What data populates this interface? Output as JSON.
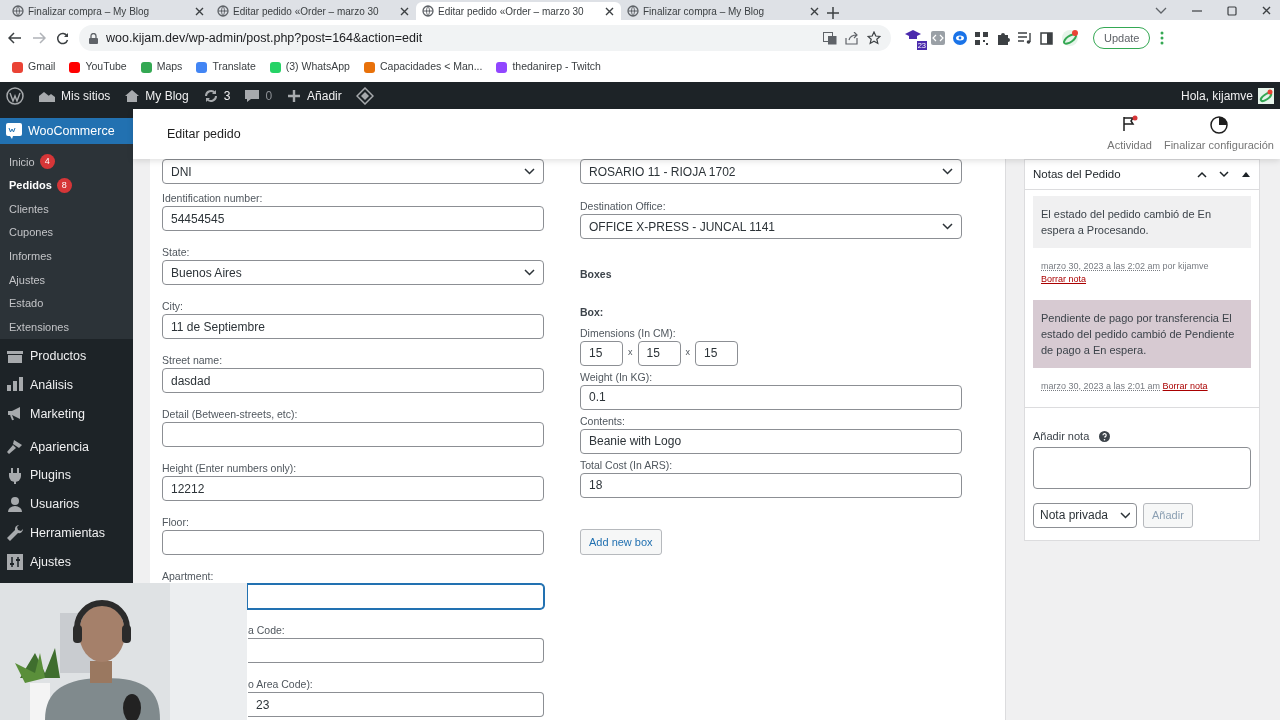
{
  "browser": {
    "tabs": [
      {
        "title": "Finalizar compra – My Blog",
        "selected": false
      },
      {
        "title": "Editar pedido «Order – marzo 30",
        "selected": false
      },
      {
        "title": "Editar pedido «Order – marzo 30",
        "selected": true
      },
      {
        "title": "Finalizar compra – My Blog",
        "selected": false
      }
    ],
    "url": "woo.kijam.dev/wp-admin/post.php?post=164&action=edit",
    "bookmarks": [
      {
        "label": "Gmail",
        "color": "#ea4335"
      },
      {
        "label": "YouTube",
        "color": "#ff0000"
      },
      {
        "label": "Maps",
        "color": "#34a853"
      },
      {
        "label": "Translate",
        "color": "#4285f4"
      },
      {
        "label": "(3) WhatsApp",
        "color": "#25d366"
      },
      {
        "label": "Capacidades < Man...",
        "color": "#e8710a"
      },
      {
        "label": "thedanirep - Twitch",
        "color": "#9146ff"
      }
    ],
    "extension_badge": "23",
    "update_button": "Update"
  },
  "admin_bar": {
    "items": [
      {
        "label": "Mis sitios",
        "kind": "sites"
      },
      {
        "label": "My Blog",
        "kind": "home"
      },
      {
        "label": "3",
        "kind": "updates"
      },
      {
        "label": "0",
        "kind": "comments"
      },
      {
        "label": "Añadir",
        "kind": "new"
      }
    ],
    "greeting": "Hola, kijamve"
  },
  "sidebar": {
    "header": {
      "label": "WooCommerce",
      "selected": true
    },
    "submenu": [
      {
        "label": "Inicio",
        "count": "4",
        "selected": false
      },
      {
        "label": "Pedidos",
        "count": "8",
        "selected": true
      },
      {
        "label": "Clientes",
        "selected": false
      },
      {
        "label": "Cupones",
        "selected": false
      },
      {
        "label": "Informes",
        "selected": false
      },
      {
        "label": "Ajustes",
        "selected": false
      },
      {
        "label": "Estado",
        "selected": false
      },
      {
        "label": "Extensiones",
        "selected": false
      }
    ],
    "menu": [
      {
        "label": "Productos",
        "kind": "products",
        "selected": false
      },
      {
        "label": "Análisis",
        "kind": "analytics",
        "selected": false
      },
      {
        "label": "Marketing",
        "kind": "marketing",
        "selected": false
      },
      {
        "label": "Apariencia",
        "kind": "appearance",
        "selected": false
      },
      {
        "label": "Plugins",
        "kind": "plugins",
        "selected": false
      },
      {
        "label": "Usuarios",
        "kind": "users",
        "selected": false
      },
      {
        "label": "Herramientas",
        "kind": "tools",
        "selected": false
      },
      {
        "label": "Ajustes",
        "kind": "settings",
        "selected": false
      }
    ]
  },
  "page_header": {
    "title": "Editar pedido",
    "actions": [
      {
        "label": "Actividad",
        "kind": "activity"
      },
      {
        "label": "Finalizar configuración",
        "kind": "setup"
      }
    ]
  },
  "form_left": [
    {
      "kind": "select",
      "value": "DNI",
      "focused": false
    },
    {
      "kind": "input",
      "label": "Identification number:",
      "value": "54454545",
      "focused": false
    },
    {
      "kind": "select",
      "label": "State:",
      "value": "Buenos Aires",
      "focused": false
    },
    {
      "kind": "input",
      "label": "City:",
      "value": "11 de Septiembre",
      "focused": false
    },
    {
      "kind": "input",
      "label": "Street name:",
      "value": "dasdad",
      "focused": false
    },
    {
      "kind": "input",
      "label": "Detail (Between-streets, etc):",
      "focused": false
    },
    {
      "kind": "input",
      "label": "Height (Enter numbers only):",
      "value": "12212",
      "focused": false
    },
    {
      "kind": "input",
      "label": "Floor:",
      "focused": false
    },
    {
      "kind": "covered_input",
      "label": "Apartment:",
      "focused": true
    },
    {
      "kind": "covered_field",
      "label": "a Code:",
      "focused": false
    },
    {
      "kind": "covered_field",
      "label": "o Area Code):",
      "value": "23",
      "focused": false
    }
  ],
  "form_right": [
    {
      "kind": "select",
      "value": "ROSARIO 11 - RIOJA 1702"
    },
    {
      "kind": "select",
      "label": "Destination Office:",
      "value": "OFFICE X-PRESS - JUNCAL 1141"
    },
    {
      "kind": "heading",
      "label": "Boxes"
    },
    {
      "kind": "subheading",
      "label": "Box:"
    },
    {
      "kind": "dimensions",
      "label": "Dimensions (In CM):",
      "values": [
        "15",
        "15",
        "15"
      ],
      "separators": [
        "x",
        "x"
      ]
    },
    {
      "kind": "input",
      "label": "Weight (In KG):",
      "value": "0.1"
    },
    {
      "kind": "input",
      "label": "Contents:",
      "value": "Beanie with Logo"
    },
    {
      "kind": "input",
      "label": "Total Cost (In ARS):",
      "value": "18"
    },
    {
      "kind": "button",
      "label": "Add new box"
    }
  ],
  "notes_panel": {
    "title": "Notas del Pedido",
    "notes": [
      {
        "kind": "private",
        "text": "El estado del pedido cambió de En espera a Procesando.",
        "date": "marzo 30, 2023 a las 2:02 am",
        "author": "por kijamve",
        "delete": "Borrar nota"
      },
      {
        "kind": "system",
        "text": "Pendiente de pago por transferencia El estado del pedido cambió de Pendiente de pago a En espera.",
        "date": "marzo 30, 2023 a las 2:01 am",
        "delete": "Borrar nota"
      }
    ],
    "add_note_label": "Añadir nota",
    "note_type": "Nota privada",
    "add_button": "Añadir"
  }
}
